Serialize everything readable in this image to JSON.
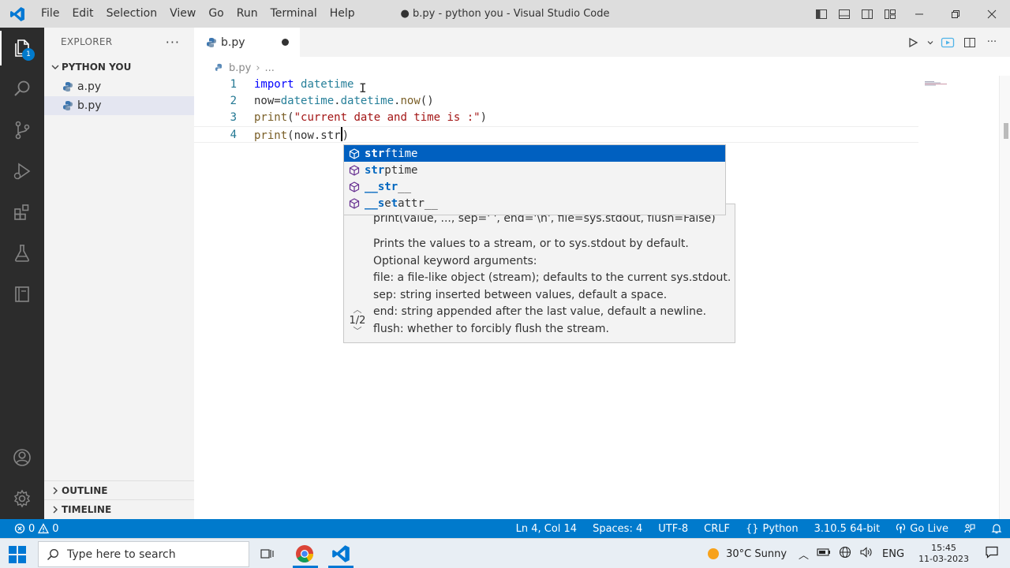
{
  "titlebar": {
    "menu": [
      "File",
      "Edit",
      "Selection",
      "View",
      "Go",
      "Run",
      "Terminal",
      "Help"
    ],
    "window_title": "● b.py - python you - Visual Studio Code"
  },
  "activitybar": {
    "explorer_badge": "1"
  },
  "sidebar": {
    "title": "EXPLORER",
    "folder": "PYTHON YOU",
    "files": [
      "a.py",
      "b.py"
    ],
    "outline": "OUTLINE",
    "timeline": "TIMELINE"
  },
  "tab": {
    "label": "b.py"
  },
  "breadcrumb": {
    "file": "b.py",
    "more": "..."
  },
  "editor": {
    "line_numbers": [
      "1",
      "2",
      "3",
      "4"
    ],
    "line1": {
      "kw": "import",
      "mod": "datetime"
    },
    "line2": {
      "a": "now=",
      "b": "datetime",
      "c": ".",
      "d": "datetime",
      "e": ".",
      "f": "now",
      "g": "()"
    },
    "line3": {
      "fn": "print",
      "open": "(",
      "str": "\"current date and time is :\"",
      "close": ")"
    },
    "line4": {
      "fn": "print",
      "code": "(now.str",
      "close": ")"
    }
  },
  "suggest": {
    "items": [
      {
        "hl": "str",
        "rest": "ftime"
      },
      {
        "hl": "str",
        "rest": "ptime"
      },
      {
        "hl": "__str",
        "rest": "__"
      },
      {
        "hl": "__s",
        "mid": "e",
        "hl2": "t",
        "rest": "attr__"
      }
    ]
  },
  "hints": {
    "signature": "print(value, ..., sep=' ', end='\\n', file=sys.stdout, flush=False)",
    "doc": [
      "Prints the values to a stream, or to sys.stdout by default.",
      "Optional keyword arguments:",
      "file: a file-like object (stream); defaults to the current sys.stdout.",
      "sep: string inserted between values, default a space.",
      "end: string appended after the last value, default a newline.",
      "flush: whether to forcibly flush the stream."
    ],
    "counter": "1/2"
  },
  "statusbar": {
    "errors": "0",
    "warnings": "0",
    "position": "Ln 4, Col 14",
    "spaces": "Spaces: 4",
    "encoding": "UTF-8",
    "eol": "CRLF",
    "language": "Python",
    "interpreter": "3.10.5 64-bit",
    "golive": "Go Live"
  },
  "taskbar": {
    "search_placeholder": "Type here to search",
    "weather": "30°C  Sunny",
    "lang": "ENG",
    "time": "15:45",
    "date": "11-03-2023"
  },
  "colors": {
    "accent": "#007acc",
    "selection": "#0060c0",
    "activitybar": "#2c2c2c"
  }
}
